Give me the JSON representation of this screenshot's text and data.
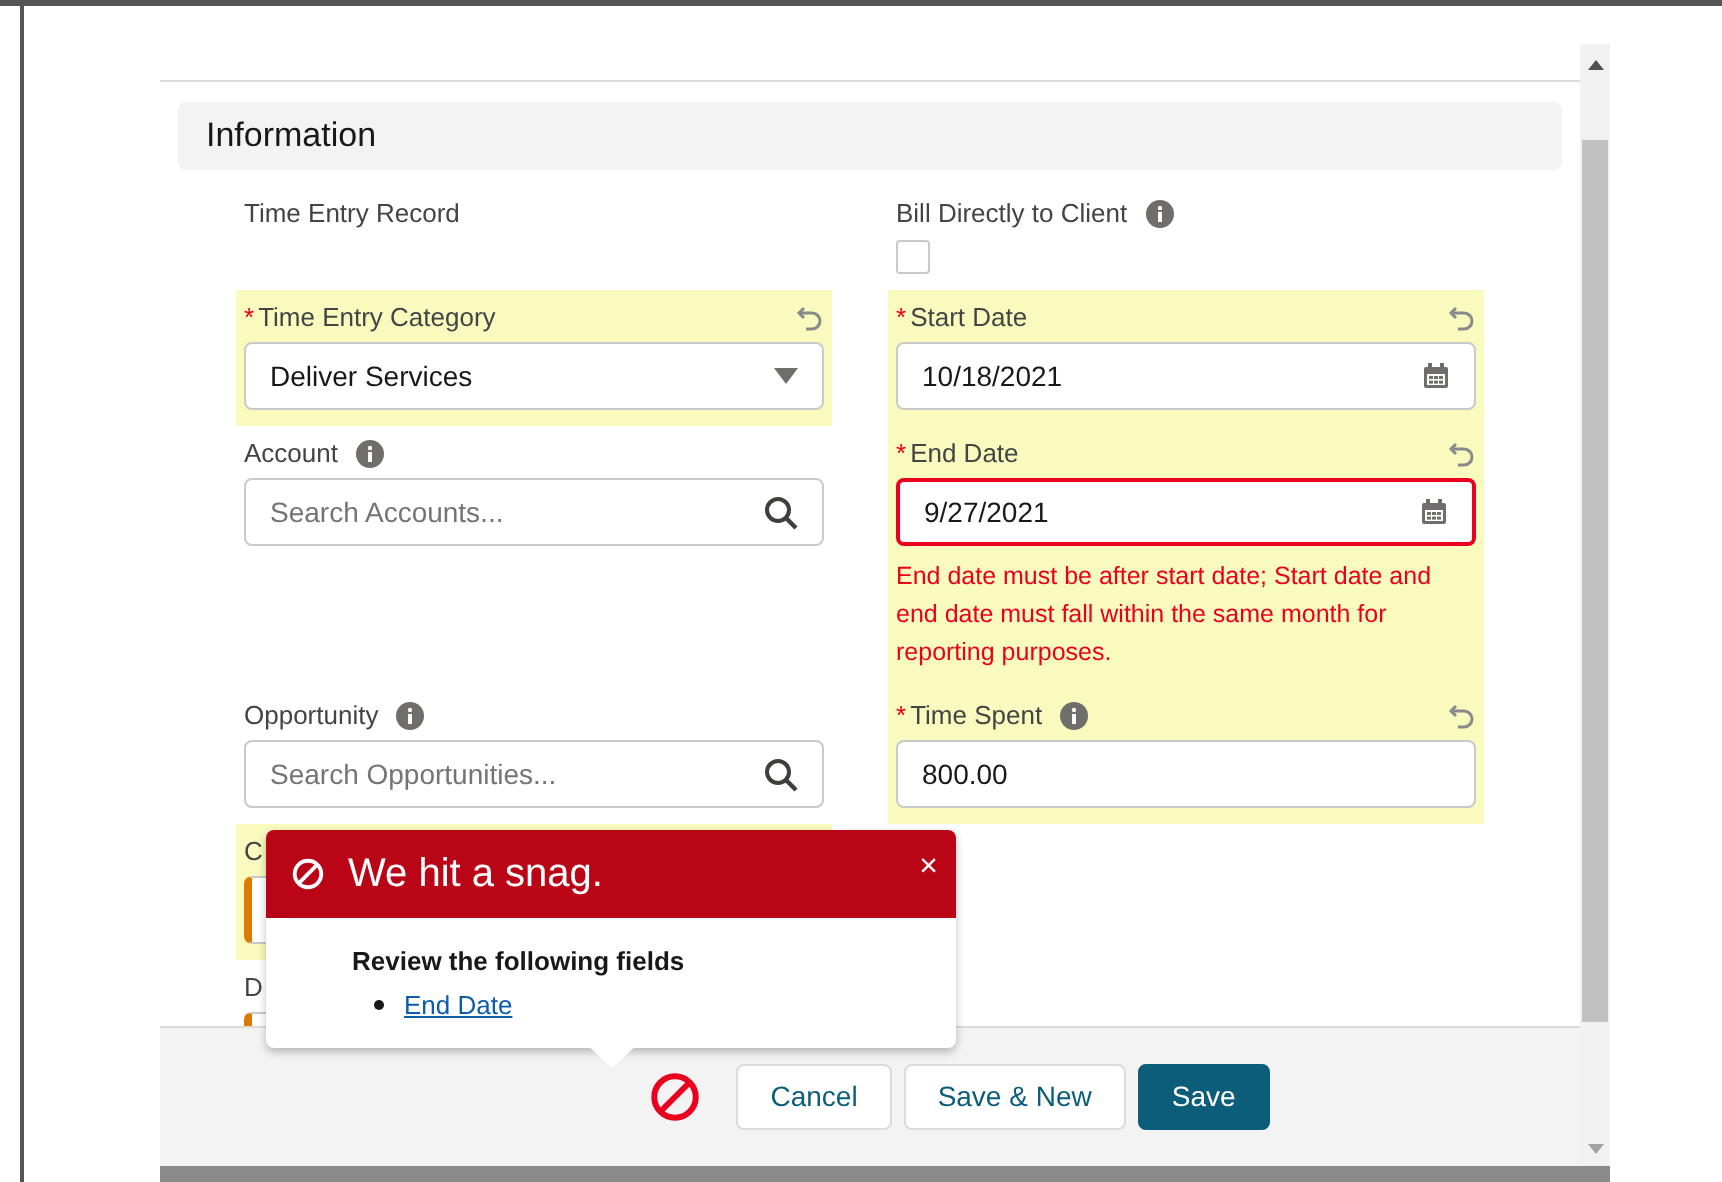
{
  "section_title": "Information",
  "rows": [
    {
      "left": {
        "label": "Time Entry Record",
        "kind": "static",
        "changed": false,
        "info": false
      },
      "right": {
        "label": "Bill Directly to Client",
        "kind": "checkbox",
        "changed": false,
        "info": true,
        "checked": false
      }
    },
    {
      "left": {
        "label": "Time Entry Category",
        "kind": "picklist",
        "required_mark": "*",
        "changed": true,
        "info": false,
        "value": "Deliver Services"
      },
      "right": {
        "label": "Start Date",
        "kind": "date",
        "required_mark": "*",
        "changed": true,
        "info": false,
        "value": "10/18/2021"
      }
    },
    {
      "left": {
        "label": "Account",
        "kind": "lookup",
        "changed": false,
        "info": true,
        "placeholder": "Search Accounts..."
      },
      "right": {
        "label": "End Date",
        "kind": "date",
        "required_mark": "*",
        "changed": true,
        "info": false,
        "value": "9/27/2021",
        "error": "End date must be after start date; Start date and end date must fall within the same month for reporting purposes."
      }
    },
    {
      "left": {
        "label": "Opportunity",
        "kind": "lookup",
        "changed": false,
        "info": true,
        "placeholder": "Search Opportunities..."
      },
      "right": {
        "label": "Time Spent",
        "kind": "number",
        "required_mark": "*",
        "changed": true,
        "info": true,
        "value": "800.00"
      }
    },
    {
      "left": {
        "label": "C",
        "kind": "partial",
        "changed": true
      }
    },
    {
      "left": {
        "label": "D",
        "kind": "partial",
        "changed": false
      }
    }
  ],
  "popover": {
    "title": "We hit a snag.",
    "close": "×",
    "heading": "Review the following fields",
    "links": [
      "End Date"
    ]
  },
  "buttons": [
    {
      "label": "Cancel",
      "kind": "neutral"
    },
    {
      "label": "Save & New",
      "kind": "neutral"
    },
    {
      "label": "Save",
      "kind": "brand"
    }
  ]
}
